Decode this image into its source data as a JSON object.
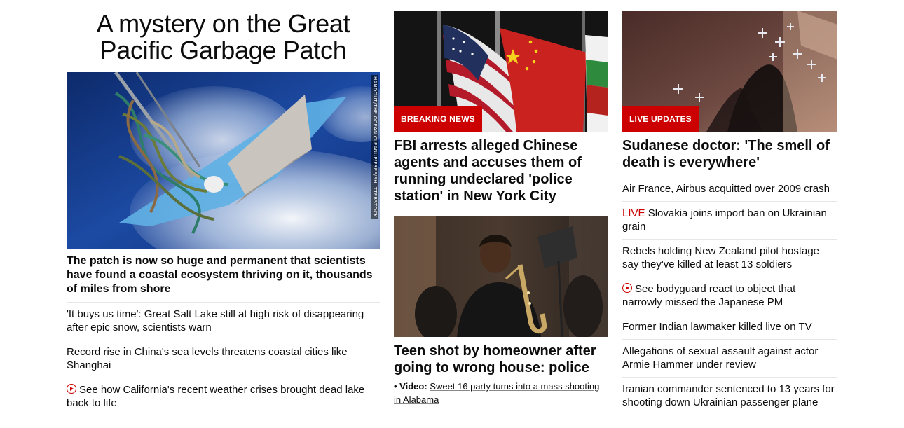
{
  "left": {
    "headline": "A mystery on the Great Pacific Garbage Patch",
    "image_credit": "HANDOUT/THE OCEAN CLEANUP/FREE/SHUTTERSTOCK",
    "lead": "The patch is now so huge and permanent that scientists have found a coastal ecosystem thriving on it, thousands of miles from shore",
    "items": [
      {
        "text": "'It buys us time': Great Salt Lake still at high risk of disappearing after epic snow, scientists warn"
      },
      {
        "text": "Record rise in China's sea levels threatens coastal cities like Shanghai"
      },
      {
        "text": "See how California's recent weather crises brought dead lake back to life",
        "icon": "play-icon"
      }
    ]
  },
  "middle": {
    "story1": {
      "badge": "BREAKING NEWS",
      "headline": "FBI arrests alleged Chinese agents and accuses them of running undeclared 'police station' in New York City"
    },
    "story2": {
      "headline": "Teen shot by homeowner after going to wrong house: police",
      "sub_bullet": "• Video:",
      "sub_link": "Sweet 16 party turns into a mass shooting in Alabama"
    }
  },
  "right": {
    "badge": "LIVE UPDATES",
    "headline": "Sudanese doctor: 'The smell of death is everywhere'",
    "items": [
      {
        "text": "Air France, Airbus acquitted over 2009 crash"
      },
      {
        "live": "LIVE",
        "text": "Slovakia joins import ban on Ukrainian grain"
      },
      {
        "text": "Rebels holding New Zealand pilot hostage say they've killed at least 13 soldiers"
      },
      {
        "text": "See bodyguard react to object that narrowly missed the Japanese PM",
        "icon": "play-icon"
      },
      {
        "text": "Former Indian lawmaker killed live on TV"
      },
      {
        "text": "Allegations of sexual assault against actor Armie Hammer under review"
      },
      {
        "text": "Iranian commander sentenced to 13 years for shooting down Ukrainian passenger plane"
      }
    ]
  },
  "colors": {
    "accent": "#cc0000",
    "text": "#0c0c0c",
    "divider": "#e6e6e6"
  }
}
